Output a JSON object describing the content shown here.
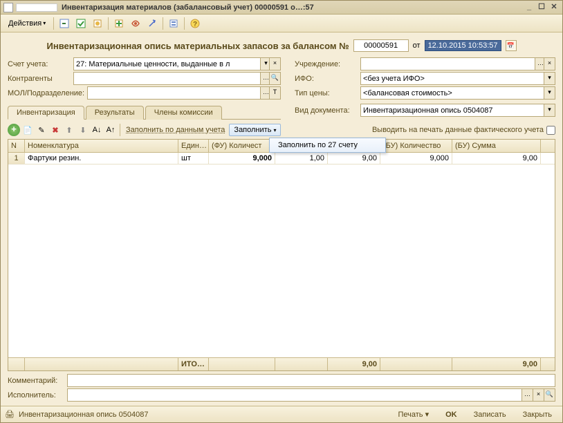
{
  "window": {
    "title": "Инвентаризация материалов (забалансовый учет) 00000591 о…:57"
  },
  "toolbar": {
    "actions": "Действия"
  },
  "header": {
    "title": "Инвентаризационная опись материальных запасов за балансом №",
    "number": "00000591",
    "from": "от",
    "date": "12.10.2015 10:53:57"
  },
  "form": {
    "account_label": "Счет учета:",
    "account_value": "27: Материальные ценности, выданные в л",
    "contr_label": "Контрагенты",
    "contr_value": "",
    "mol_label": "МОЛ/Подразделение:",
    "mol_value": "",
    "org_label": "Учреждение:",
    "org_value": "",
    "ifo_label": "ИФО:",
    "ifo_value": "<без учета ИФО>",
    "price_label": "Тип цены:",
    "price_value": "<балансовая стоимость>",
    "doctype_label": "Вид документа:",
    "doctype_value": "Инвентаризационная опись 0504087"
  },
  "tabs": {
    "t1": "Инвентаризация",
    "t2": "Результаты",
    "t3": "Члены комиссии"
  },
  "tabbar": {
    "fill_by_acct": "Заполнить по данным учета",
    "fill": "Заполнить",
    "print_fact": "Выводить на печать данные фактического учета",
    "dropdown_item": "Заполнить по 27 счету"
  },
  "grid": {
    "headers": {
      "n": "N",
      "nom": "Номенклатура",
      "ed": "Един…",
      "fk": "(ФУ) Количест",
      "fs": "",
      "f3": "",
      "bk": "(БУ) Количество",
      "bs": "(БУ) Сумма"
    },
    "rows": [
      {
        "n": "1",
        "nom": "Фартуки резин.",
        "ed": "шт",
        "fk": "9,000",
        "fs": "1,00",
        "f3": "9,00",
        "bk": "9,000",
        "bs": "9,00"
      }
    ],
    "footer": {
      "label": "ИТО…",
      "f3": "9,00",
      "bs": "9,00"
    }
  },
  "bottom": {
    "comment_label": "Комментарий:",
    "exec_label": "Исполнитель:"
  },
  "status": {
    "doc": "Инвентаризационная опись 0504087",
    "print": "Печать",
    "ok": "OK",
    "save": "Записать",
    "close": "Закрыть"
  }
}
